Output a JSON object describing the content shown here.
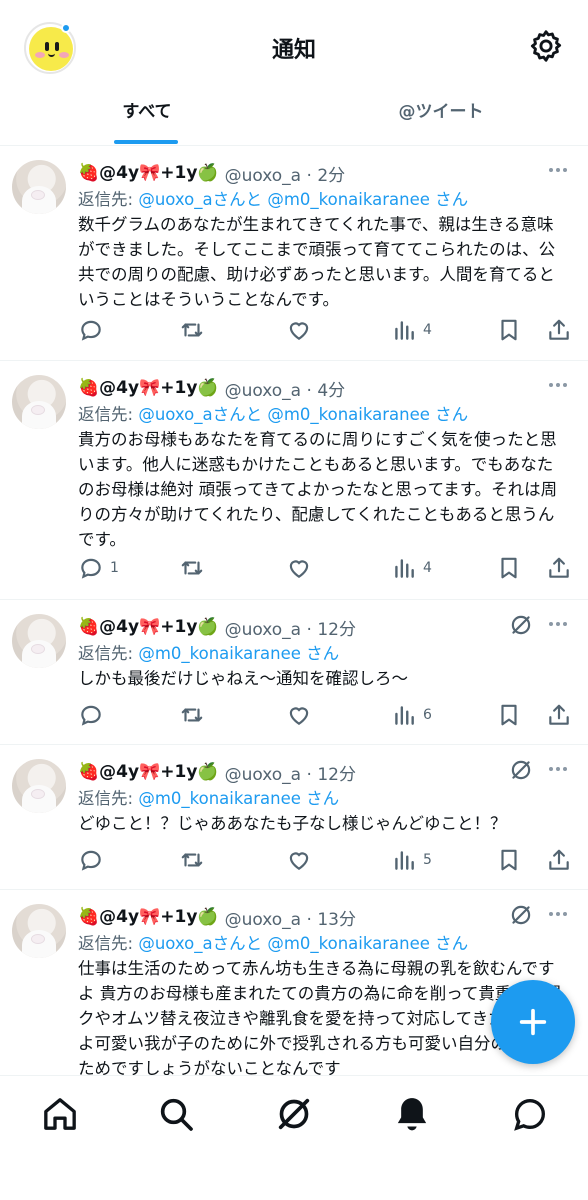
{
  "header": {
    "title": "通知",
    "avatar_icon": "yellow-face-avatar",
    "settings_icon": "gear-icon"
  },
  "tabs": [
    {
      "label": "すべて",
      "active": true
    },
    {
      "label": "@ツイート",
      "active": false
    }
  ],
  "tweets": [
    {
      "name": "🍓@4y🎀+1y🍏",
      "handle": "@uoxo_a",
      "time": "2分",
      "reply_prefix": "返信先: ",
      "reply_to": "@uoxo_aさんと @m0_konaikaranee さん",
      "lines": [
        "数千グラムのあなたが生まれてきてくれた事で、親は生きる意味",
        "ができました。そしてここまで頑張って育ててこられたのは、公",
        "共での周りの配慮、助け必ずあったと思います。人間を育てると",
        "いうことはそういうことなんです。"
      ],
      "replies": "",
      "views": "4",
      "show_grok": false
    },
    {
      "name": "🍓@4y🎀+1y🍏",
      "handle": "@uoxo_a",
      "time": "4分",
      "reply_prefix": "返信先: ",
      "reply_to": "@uoxo_aさんと @m0_konaikaranee さん",
      "lines": [
        "貴方のお母様もあなたを育てるのに周りにすごく気を使ったと思",
        "います。他人に迷惑もかけたこともあると思います。でもあなた",
        "のお母様は絶対 頑張ってきてよかったなと思ってます。それは周",
        "りの方々が助けてくれたり、配慮してくれたこともあると思うん",
        "です。"
      ],
      "replies": "1",
      "views": "4",
      "show_grok": false
    },
    {
      "name": "🍓@4y🎀+1y🍏",
      "handle": "@uoxo_a",
      "time": "12分",
      "reply_prefix": "返信先: ",
      "reply_to": "@m0_konaikaranee さん",
      "lines": [
        "しかも最後だけじゃねえ〜通知を確認しろ〜"
      ],
      "replies": "",
      "views": "6",
      "show_grok": true
    },
    {
      "name": "🍓@4y🎀+1y🍏",
      "handle": "@uoxo_a",
      "time": "12分",
      "reply_prefix": "返信先: ",
      "reply_to": "@m0_konaikaranee さん",
      "lines": [
        "どゆこと！？じゃああなたも子なし様じゃんどゆこと！？"
      ],
      "replies": "",
      "views": "5",
      "show_grok": true
    },
    {
      "name": "🍓@4y🎀+1y🍏",
      "handle": "@uoxo_a",
      "time": "13分",
      "reply_prefix": "返信先: ",
      "reply_to": "@uoxo_aさんと @m0_konaikaranee さん",
      "lines": [
        "仕事は生活のためって赤ん坊も生きる為に母親の乳を飲むんです",
        "よ 貴方のお母様も産まれたての貴方の為に命を削って貴重な時間",
        "クやオムツ替え夜泣きや離乳食を愛を持って対応してきたと思い",
        "よ可愛い我が子のために外で授乳される方も可愛い自分の",
        "ためですしょうがないことなんです"
      ],
      "replies": "",
      "views": "",
      "show_grok": true
    }
  ],
  "fab": {
    "icon": "plus-icon"
  },
  "bottom_nav": [
    {
      "name": "home-icon"
    },
    {
      "name": "search-icon"
    },
    {
      "name": "grok-icon"
    },
    {
      "name": "bell-icon",
      "active": true
    },
    {
      "name": "messages-icon"
    }
  ],
  "colors": {
    "accent": "#1d9bf0",
    "text": "#0f1419",
    "muted": "#536471"
  }
}
